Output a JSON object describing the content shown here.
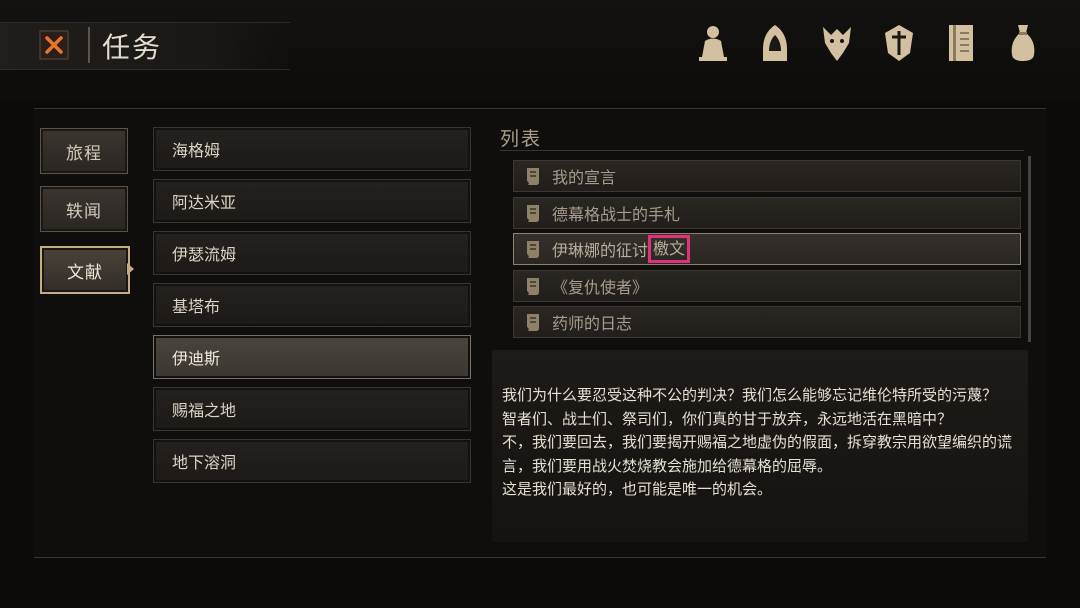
{
  "header": {
    "title": "任务"
  },
  "top_icons": [
    "character-icon",
    "hood-icon",
    "creature-icon",
    "crest-icon",
    "journal-icon",
    "bag-icon"
  ],
  "categories": [
    {
      "label": "旅程",
      "active": false
    },
    {
      "label": "轶闻",
      "active": false
    },
    {
      "label": "文献",
      "active": true
    }
  ],
  "locations": [
    {
      "label": "海格姆",
      "selected": false
    },
    {
      "label": "阿达米亚",
      "selected": false
    },
    {
      "label": "伊瑟流姆",
      "selected": false
    },
    {
      "label": "基塔布",
      "selected": false
    },
    {
      "label": "伊迪斯",
      "selected": true
    },
    {
      "label": "赐福之地",
      "selected": false
    },
    {
      "label": "地下溶洞",
      "selected": false
    }
  ],
  "list": {
    "title": "列表",
    "items": [
      {
        "label": "我的宣言"
      },
      {
        "label": "德幕格战士的手札"
      },
      {
        "label_prefix": "伊琳娜的征讨",
        "label_highlight": "檄文"
      },
      {
        "label": "《复仇使者》"
      },
      {
        "label": "药师的日志"
      }
    ]
  },
  "description": {
    "lines": [
      "我们为什么要忍受这种不公的判决？我们怎么能够忘记维伦特所受的污蔑？",
      "智者们、战士们、祭司们，你们真的甘于放弃，永远地活在黑暗中？",
      "不，我们要回去，我们要揭开赐福之地虚伪的假面，拆穿教宗用欲望编织的谎言，我们要用战火焚烧教会施加给德幕格的屈辱。",
      "这是我们最好的，也可能是唯一的机会。"
    ]
  },
  "colors": {
    "highlight": "#e0317a",
    "accent": "#c4ad85"
  }
}
